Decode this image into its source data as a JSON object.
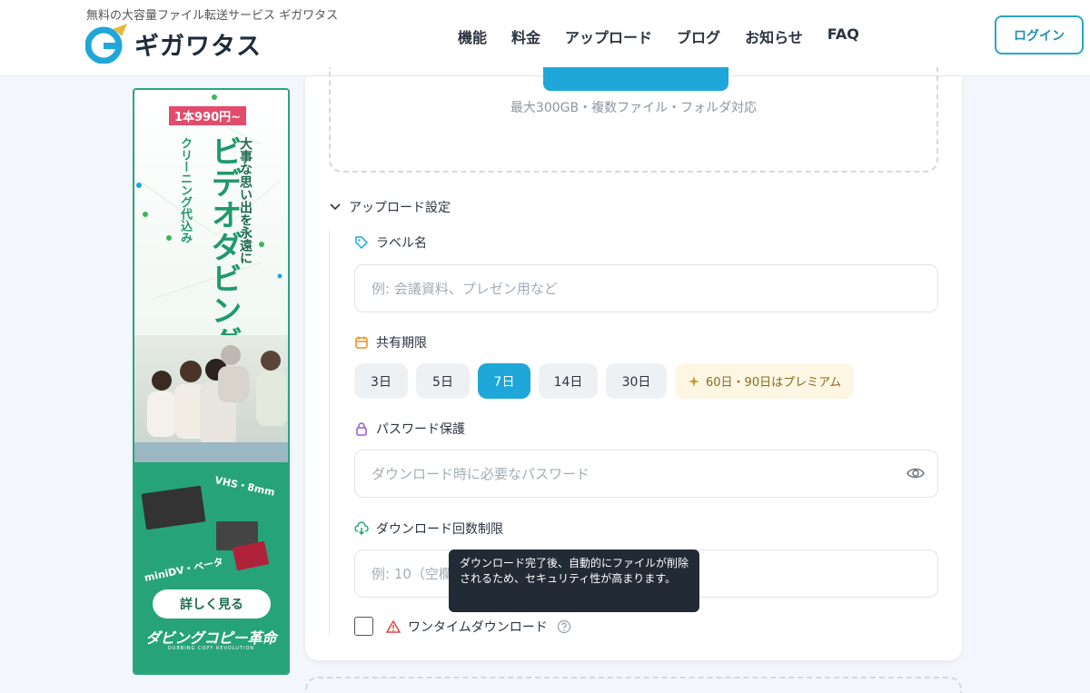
{
  "header": {
    "tagline": "無料の大容量ファイル転送サービス ギガワタス",
    "logo_text": "ギガワタス",
    "nav": [
      "機能",
      "料金",
      "アップロード",
      "ブログ",
      "お知らせ",
      "FAQ"
    ],
    "login": "ログイン"
  },
  "ad": {
    "price": "1本990円~",
    "headline": "ビデオダビング",
    "sub1": "大事な思い出を永遠に",
    "sub2": "クリーニング代込み",
    "formats1": "VHS・8mm",
    "formats2": "miniDV・ベータ",
    "button": "詳しく見る",
    "brand": "ダビングコピー革命",
    "brand_sub": "DUBBING COPY REVOLUTION"
  },
  "upload": {
    "limit_note": "最大300GB・複数ファイル・フォルダ対応"
  },
  "settings": {
    "title": "アップロード設定",
    "label_field": {
      "label": "ラベル名",
      "placeholder": "例: 会議資料、プレゼン用など"
    },
    "expiry": {
      "label": "共有期限",
      "options": [
        "3日",
        "5日",
        "7日",
        "14日",
        "30日"
      ],
      "selected": "7日",
      "premium_note": "60日・90日はプレミアム"
    },
    "password": {
      "label": "パスワード保護",
      "placeholder": "ダウンロード時に必要なパスワード"
    },
    "download_limit": {
      "label": "ダウンロード回数制限",
      "placeholder": "例: 10（空欄で無制限）"
    },
    "one_time": {
      "label": "ワンタイムダウンロード",
      "tooltip": "ダウンロード完了後、自動的にファイルが削除されるため、セキュリティ性が高まります。"
    }
  },
  "colors": {
    "accent": "#1ea7d8",
    "ad_green": "#27a37a",
    "premium_bg": "#fdf6e3"
  }
}
